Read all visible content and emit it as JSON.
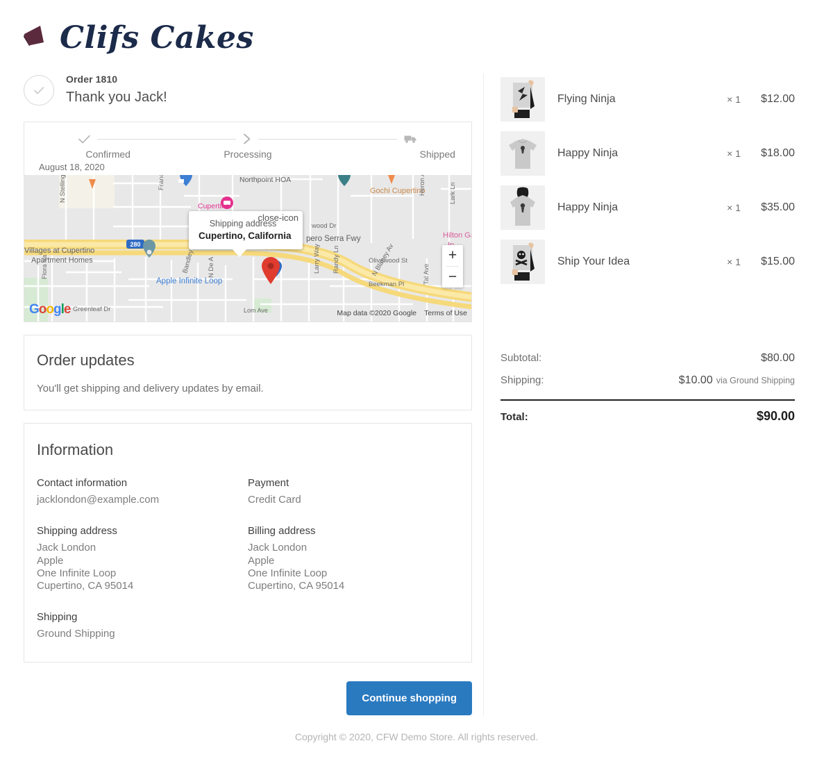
{
  "brand": {
    "name": "Clifs Cakes",
    "mark_color": "#5c2a3d",
    "name_color": "#1c2b4a",
    "mark_icon": "cake-slice-icon"
  },
  "confirmation": {
    "check_icon": "check-circle-icon",
    "order_number": "Order 1810",
    "thank_you": "Thank you Jack!"
  },
  "tracker": {
    "steps": [
      {
        "label": "Confirmed",
        "icon": "check-icon",
        "date": "August 18, 2020"
      },
      {
        "label": "Processing",
        "icon": "chevron-right-icon",
        "date": ""
      },
      {
        "label": "Shipped",
        "icon": "truck-icon",
        "date": ""
      }
    ],
    "date": "August 18, 2020"
  },
  "map": {
    "bubble_title": "Shipping address",
    "bubble_place": "Cupertino, California",
    "close_icon": "close-icon",
    "zoom_in": "+",
    "zoom_out": "−",
    "attribution": "Map data ©2020 Google",
    "terms": "Terms of Use",
    "logo_letters": [
      "G",
      "o",
      "o",
      "g",
      "l",
      "e"
    ],
    "marker_icon": "map-pin-icon",
    "labels": [
      "N Stelling Rd",
      "Franco Ct",
      "Northpoint HOA",
      "Gochi Cupertino",
      "Heron Ave",
      "Lark Ln",
      "Hilton Ga",
      "I 280",
      "Villages at Cupertino",
      "Apartment Homes",
      "wood Dr",
      "pero Serra Fwy",
      "Olivewood St",
      "Apple Infinite Loop",
      "Larry Way",
      "Randy Ln",
      "N Blaney Av",
      "Beekman Pl",
      "Flora Va",
      "Bandley Dr",
      "N De A",
      "Greenleaf Dr",
      "Lom Ave",
      "Tal Ave",
      "Cupertino"
    ]
  },
  "order_updates": {
    "title": "Order updates",
    "text": "You'll get shipping and delivery updates by email."
  },
  "information": {
    "title": "Information",
    "contact_heading": "Contact information",
    "contact_value": "jacklondon@example.com",
    "payment_heading": "Payment",
    "payment_value": "Credit Card",
    "shipping_address_heading": "Shipping address",
    "shipping_address_value": "Jack London\nApple\nOne Infinite Loop\nCupertino, CA 95014",
    "billing_address_heading": "Billing address",
    "billing_address_value": "Jack London\nApple\nOne Infinite Loop\nCupertino, CA 95014",
    "shipping_heading": "Shipping",
    "shipping_value": "Ground Shipping"
  },
  "actions": {
    "continue_label": "Continue shopping",
    "continue_color": "#2a7ac0"
  },
  "order_items": [
    {
      "name": "Flying Ninja",
      "qty": "× 1",
      "price": "$12.00",
      "thumb": "tshirt-held-flying-ninja"
    },
    {
      "name": "Happy Ninja",
      "qty": "× 1",
      "price": "$18.00",
      "thumb": "tshirt-grey-happy-ninja"
    },
    {
      "name": "Happy Ninja",
      "qty": "× 1",
      "price": "$35.00",
      "thumb": "hoodie-grey-happy-ninja"
    },
    {
      "name": "Ship Your Idea",
      "qty": "× 1",
      "price": "$15.00",
      "thumb": "tshirt-held-ship-your-idea"
    }
  ],
  "totals": {
    "subtotal_label": "Subtotal:",
    "subtotal_value": "$80.00",
    "shipping_label": "Shipping:",
    "shipping_value": "$10.00",
    "shipping_note": "via Ground Shipping",
    "total_label": "Total:",
    "total_value": "$90.00"
  },
  "footer": {
    "copyright": "Copyright © 2020, CFW Demo Store. All rights reserved."
  }
}
